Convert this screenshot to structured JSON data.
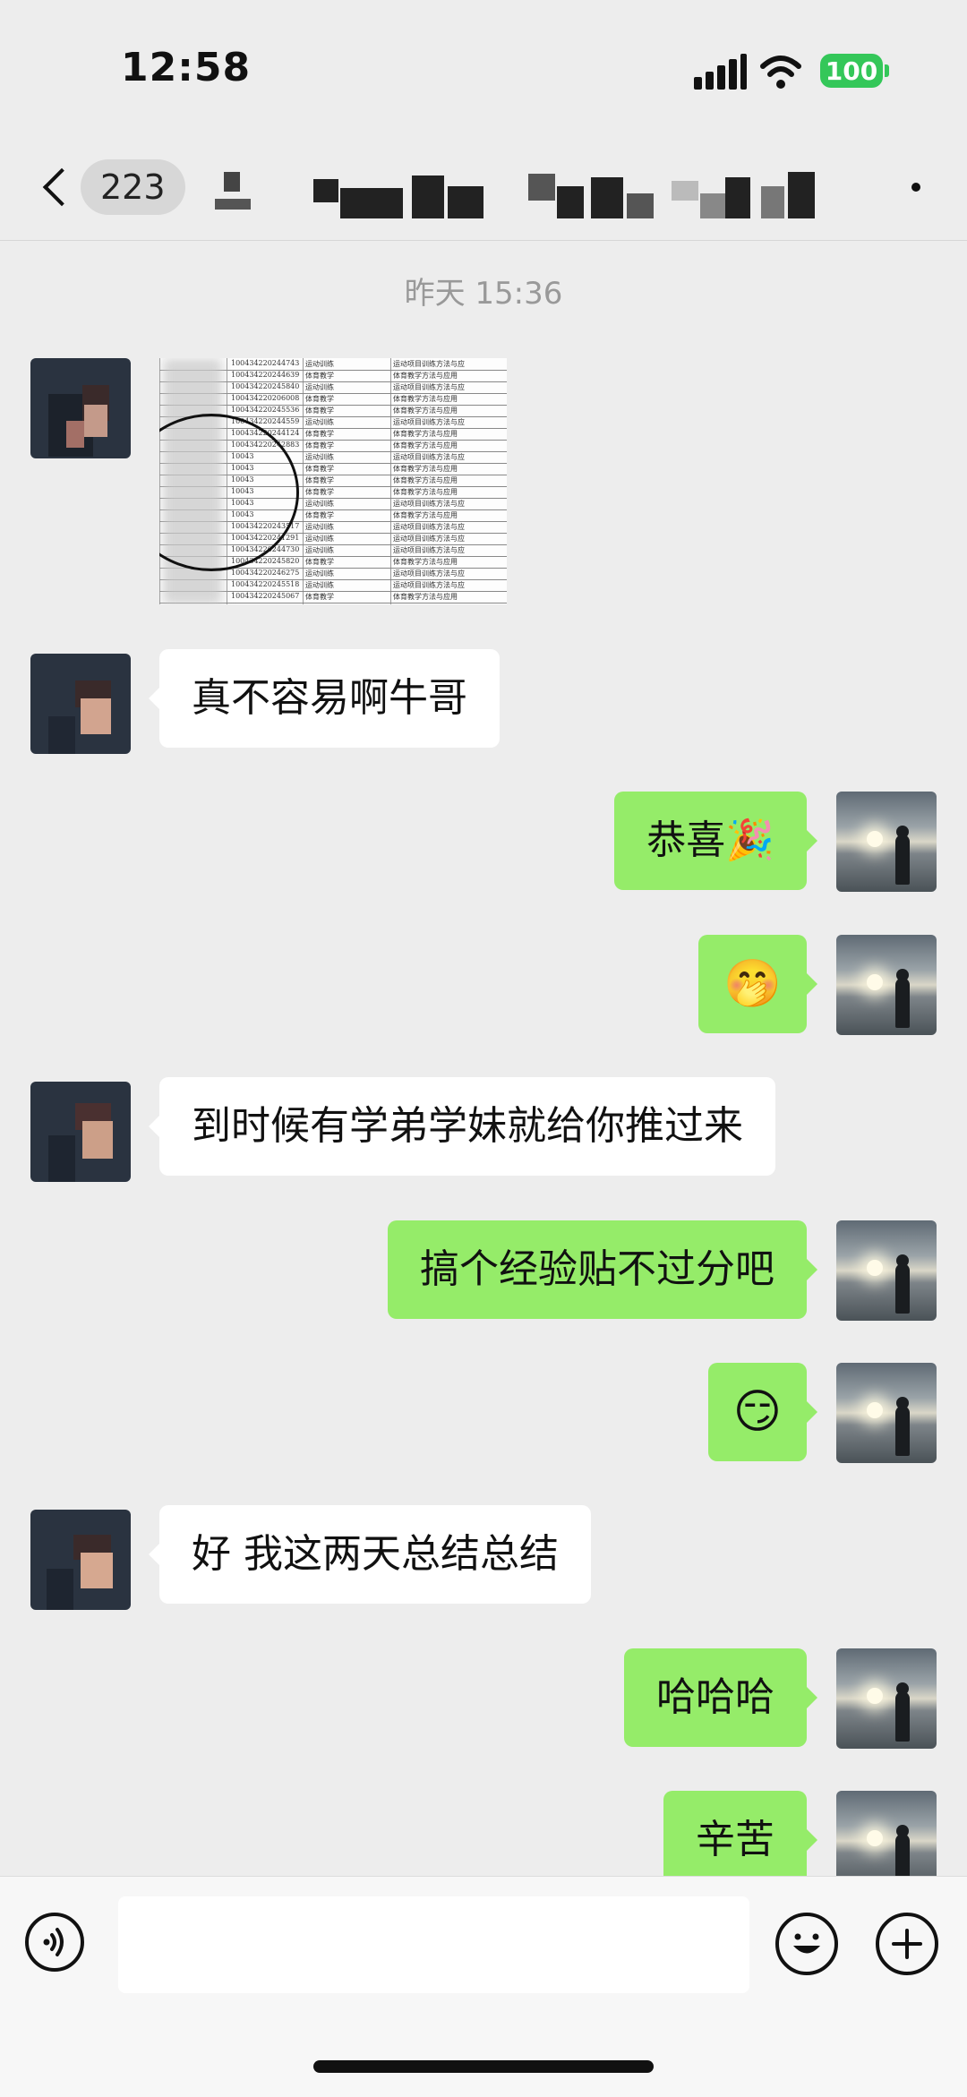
{
  "status_bar": {
    "time": "12:58",
    "battery": "100"
  },
  "header": {
    "unread_count": "223"
  },
  "chat": {
    "timestamp": "昨天 15:36",
    "messages": [
      {
        "from": "other",
        "type": "image"
      },
      {
        "from": "other",
        "text": "真不容易啊牛哥"
      },
      {
        "from": "me",
        "text": "恭喜🎉"
      },
      {
        "from": "me",
        "text": "🤭"
      },
      {
        "from": "other",
        "text": "到时候有学弟学妹就给你推过来"
      },
      {
        "from": "me",
        "text": "搞个经验贴不过分吧"
      },
      {
        "from": "me",
        "text": "😏"
      },
      {
        "from": "other",
        "text": "好 我这两天总结总结"
      },
      {
        "from": "me",
        "text": "哈哈哈"
      },
      {
        "from": "me",
        "text": "辛苦"
      }
    ],
    "image_table": {
      "ids": [
        "100434220244743",
        "100434220244639",
        "100434220245840",
        "100434220206008",
        "100434220245536",
        "100434220244559",
        "100434220244124",
        "100434220242883",
        "10043",
        "10043",
        "10043",
        "10043",
        "10043",
        "10043",
        "100434220243517",
        "100434220241291",
        "100434220244730",
        "100434220245820",
        "100434220246275",
        "100434220245518",
        "100434220245067"
      ],
      "majors": [
        "运动训练",
        "体育教学",
        "运动训练",
        "体育教学",
        "体育教学",
        "运动训练",
        "体育教学",
        "体育教学",
        "运动训练",
        "体育教学",
        "体育教学",
        "体育教学",
        "运动训练",
        "体育教学",
        "运动训练",
        "运动训练",
        "运动训练",
        "体育教学",
        "运动训练",
        "运动训练",
        "体育教学"
      ],
      "directions": [
        "运动项目训练方法与应",
        "体育教学方法与应用",
        "运动项目训练方法与应",
        "体育教学方法与应用",
        "体育教学方法与应用",
        "运动项目训练方法与应",
        "体育教学方法与应用",
        "体育教学方法与应用",
        "运动项目训练方法与应",
        "体育教学方法与应用",
        "体育教学方法与应用",
        "体育教学方法与应用",
        "运动项目训练方法与应",
        "体育教学方法与应用",
        "运动项目训练方法与应",
        "运动项目训练方法与应",
        "运动项目训练方法与应",
        "体育教学方法与应用",
        "运动项目训练方法与应",
        "运动项目训练方法与应",
        "体育教学方法与应用"
      ]
    }
  },
  "input": {
    "placeholder": ""
  },
  "colors": {
    "outgoing_bubble": "#95ec69",
    "incoming_bubble": "#ffffff",
    "background": "#ededed"
  }
}
